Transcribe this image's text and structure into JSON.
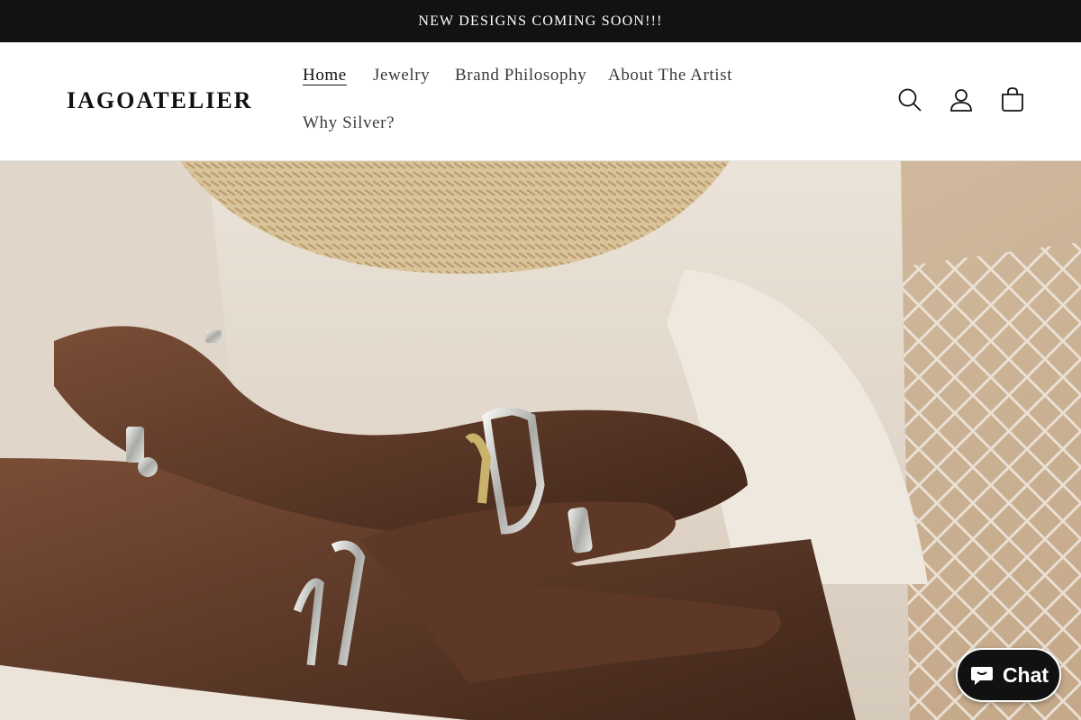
{
  "announcement": {
    "text": "NEW DESIGNS COMING SOON!!!"
  },
  "header": {
    "logo": "IAGOATELIER",
    "nav": [
      {
        "label": "Home",
        "active": true
      },
      {
        "label": "Jewelry",
        "active": false
      },
      {
        "label": "Brand Philosophy",
        "active": false
      },
      {
        "label": "About The Artist",
        "active": false
      },
      {
        "label": "Why Silver?",
        "active": false
      }
    ],
    "icons": [
      "search-icon",
      "account-icon",
      "cart-icon"
    ]
  },
  "hero": {
    "image": "hands-with-silver-jewelry-photo"
  },
  "chat": {
    "label": "Chat",
    "icon": "chat-bubble-icon"
  },
  "colors": {
    "announcement_bg": "#121212",
    "chat_bg": "#111111",
    "text": "#121212"
  }
}
